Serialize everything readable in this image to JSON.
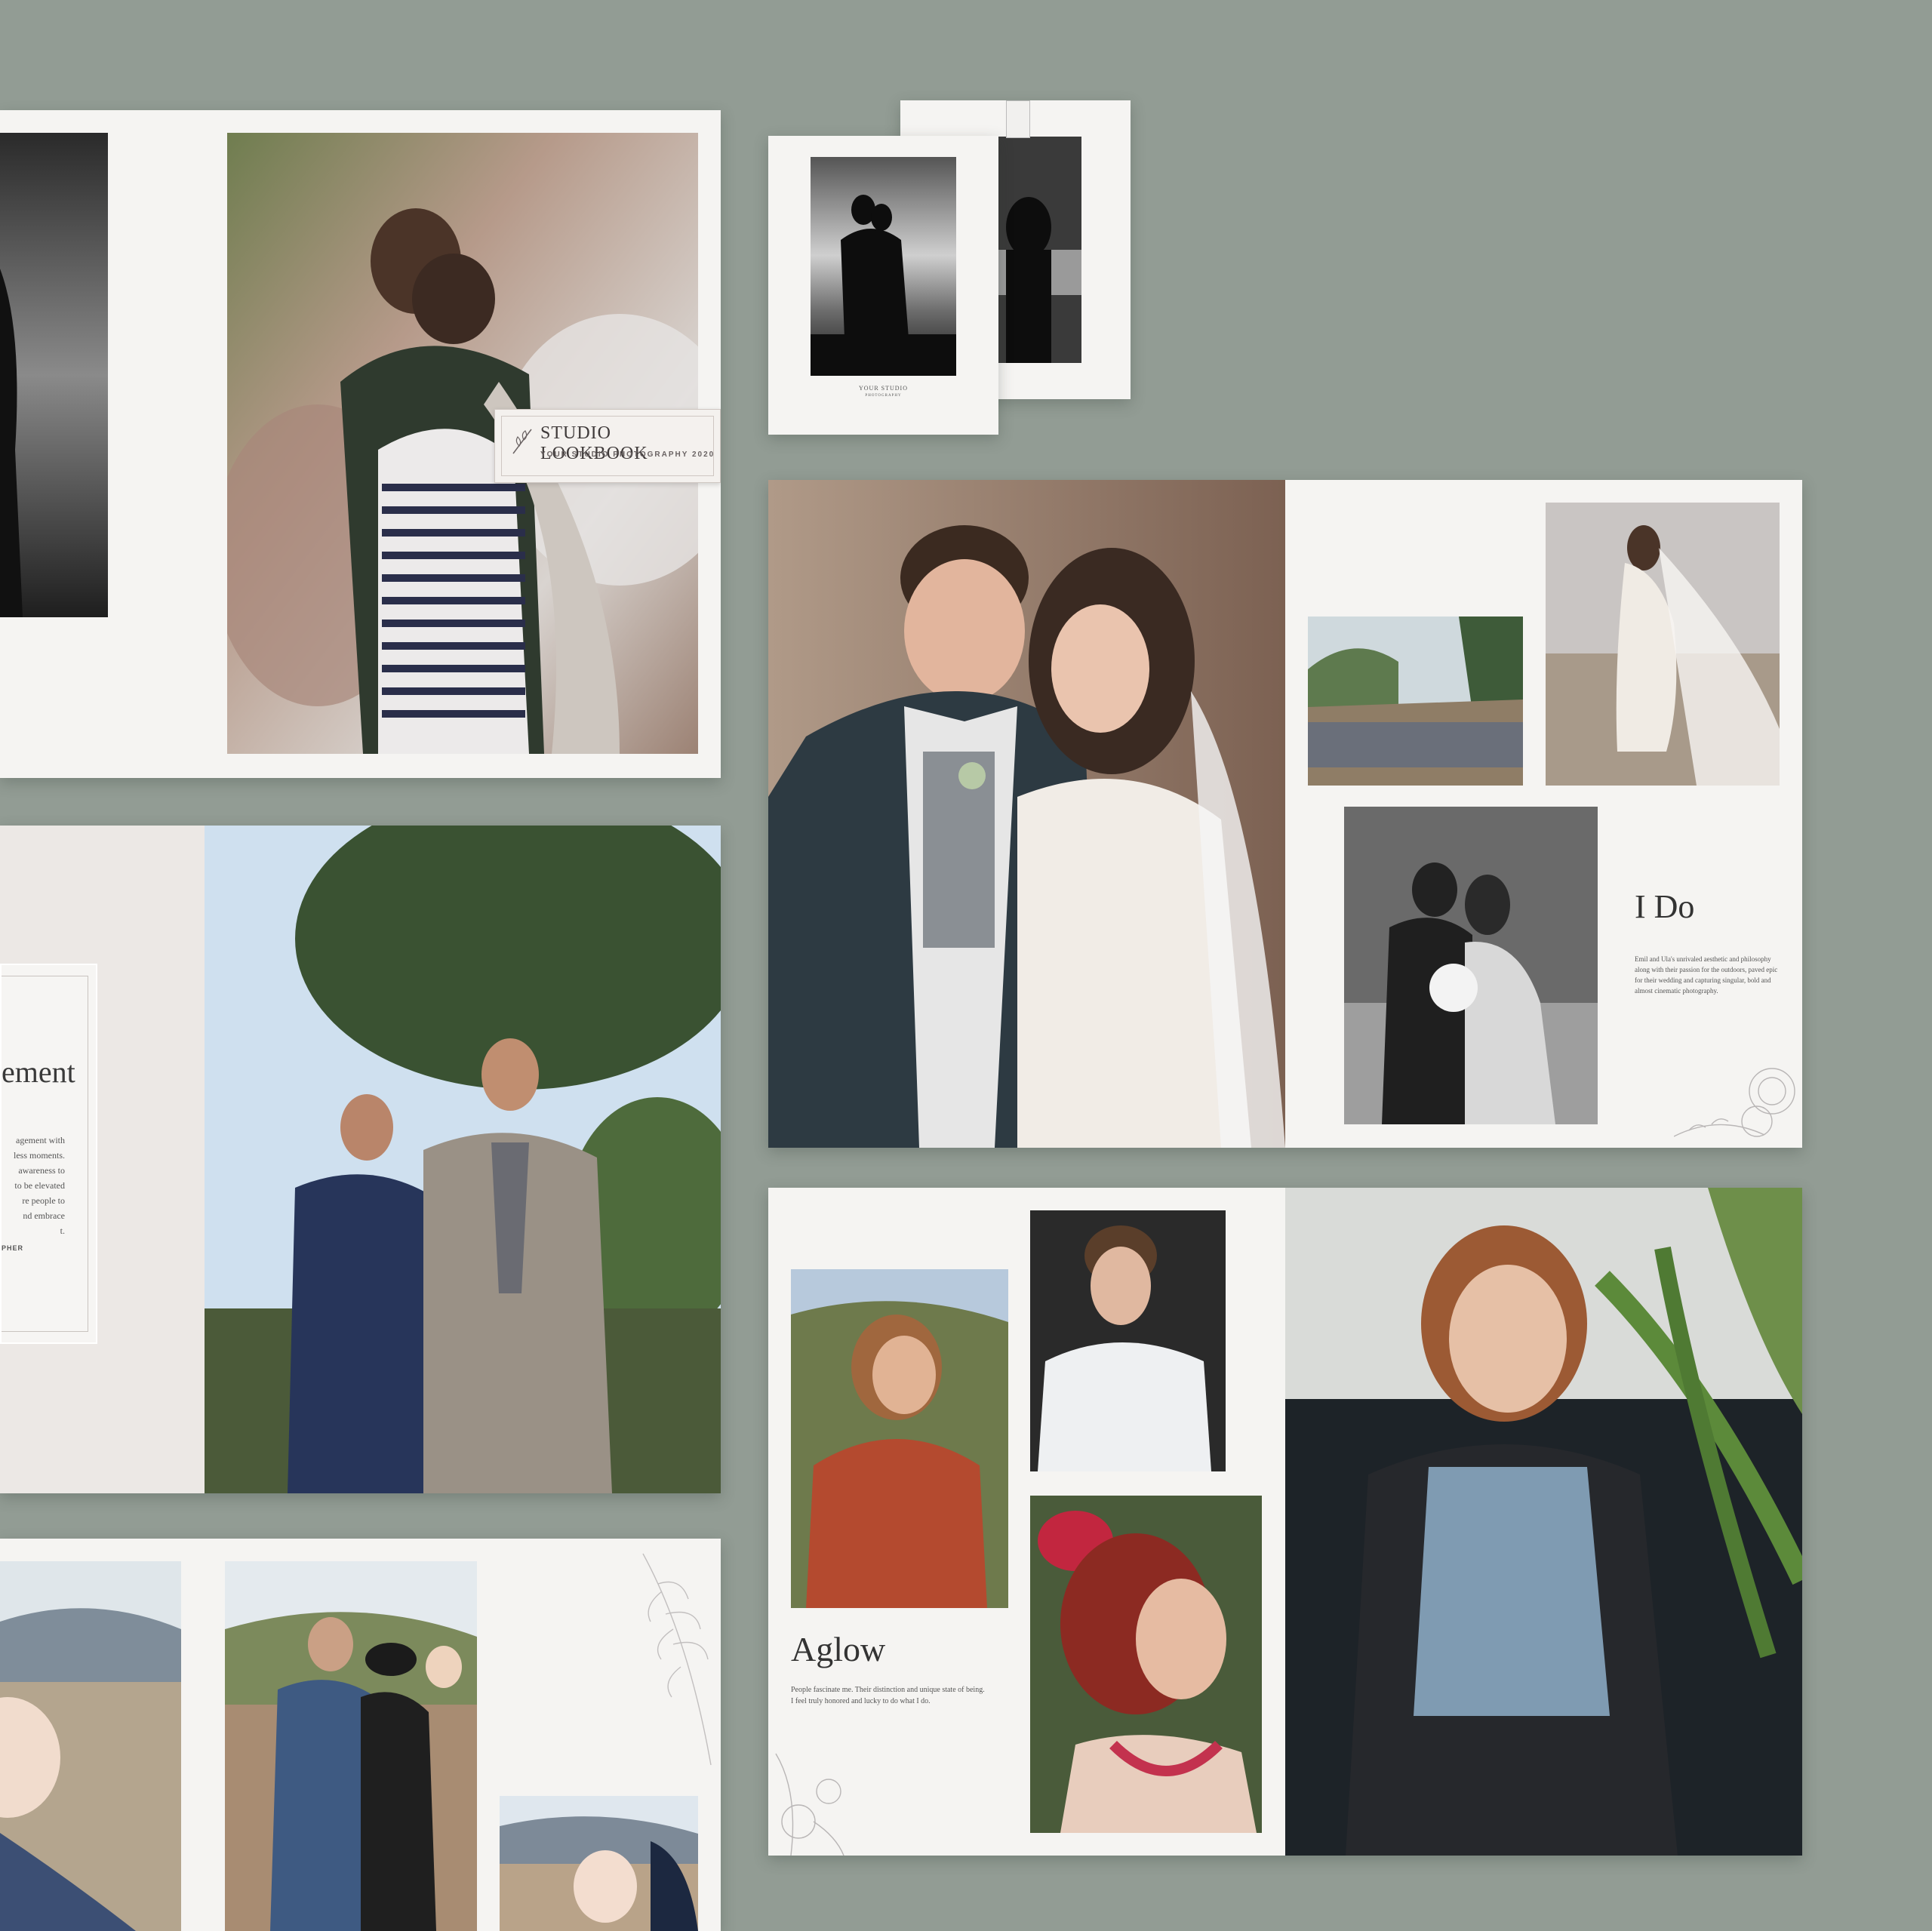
{
  "lookbook": {
    "title": "STUDIO LOOKBOOK",
    "subtitle": "YOUR STUDIO PHOTOGRAPHY 2020"
  },
  "cards": {
    "studio_name": "YOUR STUDIO",
    "studio_sub": "PHOTOGRAPHY"
  },
  "engagement": {
    "title_fragment": "ement",
    "text_fragment": "agement with\nless moments.\nawareness to\nto be elevated\nre people to\nnd embrace\nt.",
    "credit_fragment": "PHER"
  },
  "ido": {
    "title": "I Do",
    "body": "Emil and Ula's unrivaled aesthetic and philosophy along with their passion for the outdoors, paved epic for their wedding and capturing singular, bold and almost cinematic photography."
  },
  "aglow": {
    "title": "Aglow",
    "body": "People fascinate me. Their distinction and unique state of being. I feel truly honored and lucky to do what I do."
  },
  "colors": {
    "background": "#929c94",
    "paper": "#f5f4f2"
  }
}
